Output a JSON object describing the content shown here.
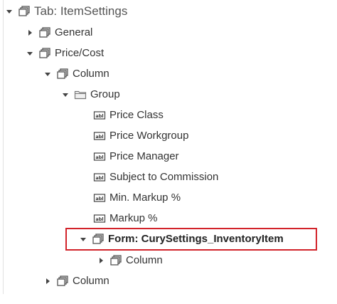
{
  "tree": {
    "root": {
      "label": "Tab: ItemSettings",
      "expanded": true
    },
    "general": {
      "label": "General",
      "expanded": false
    },
    "price_cost": {
      "label": "Price/Cost",
      "expanded": true
    },
    "column1": {
      "label": "Column",
      "expanded": true
    },
    "group": {
      "label": "Group",
      "expanded": true
    },
    "fields": [
      {
        "label": "Price Class"
      },
      {
        "label": "Price Workgroup"
      },
      {
        "label": "Price Manager"
      },
      {
        "label": "Subject to Commission"
      },
      {
        "label": "Min. Markup %"
      },
      {
        "label": "Markup %"
      }
    ],
    "form": {
      "label": "Form: CurySettings_InventoryItem",
      "expanded": true,
      "highlight_color": "#d2232a"
    },
    "form_column": {
      "label": "Column",
      "expanded": false
    },
    "column2": {
      "label": "Column",
      "expanded": false
    }
  },
  "icons": {
    "container": "stacked-pages-icon",
    "group": "folder-icon",
    "field": "text-field-icon",
    "expanded": "caret-down-icon",
    "collapsed": "caret-right-icon"
  }
}
